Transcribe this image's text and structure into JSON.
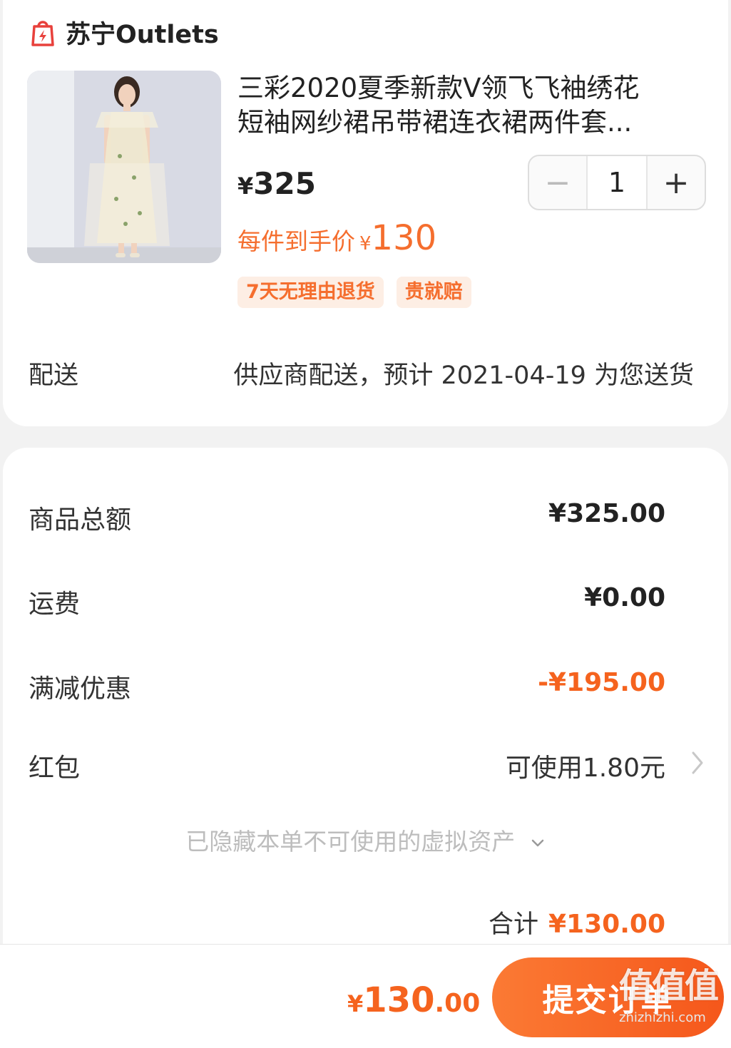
{
  "store": {
    "name": "苏宁Outlets",
    "icon": "shopping-bag-lightning-icon"
  },
  "product": {
    "title_line1": "三彩2020夏季新款V领飞飞袖绣花",
    "title_line2": "短袖网纱裙吊带裙连衣裙两件套...",
    "price_symbol": "¥",
    "price": "325",
    "quantity": "1",
    "minus": "−",
    "plus": "+",
    "hand_price_label": "每件到手价",
    "hand_price_symbol": "¥",
    "hand_price": "130",
    "tags": [
      "7天无理由退货",
      "贵就赔"
    ]
  },
  "delivery": {
    "label": "配送",
    "value": "供应商配送，预计 2021-04-19 为您送货"
  },
  "summary": {
    "goods_total_label": "商品总额",
    "goods_total": "¥325.00",
    "shipping_label": "运费",
    "shipping": "¥0.00",
    "discount_label": "满减优惠",
    "discount": "-¥195.00",
    "red_packet_label": "红包",
    "red_packet": "可使用1.80元",
    "hidden_assets_note": "已隐藏本单不可使用的虚拟资产",
    "total_label": "合计",
    "total": "¥130.00"
  },
  "footer": {
    "price_symbol": "¥",
    "price_int": "130",
    "price_dec": ".00",
    "submit_label": "提交订单"
  },
  "watermark": {
    "logo": "值值值",
    "site": "zhizhizhi.com"
  },
  "colors": {
    "accent": "#f5631e",
    "tag_bg": "#fdeee4",
    "store_icon": "#e8413c"
  }
}
